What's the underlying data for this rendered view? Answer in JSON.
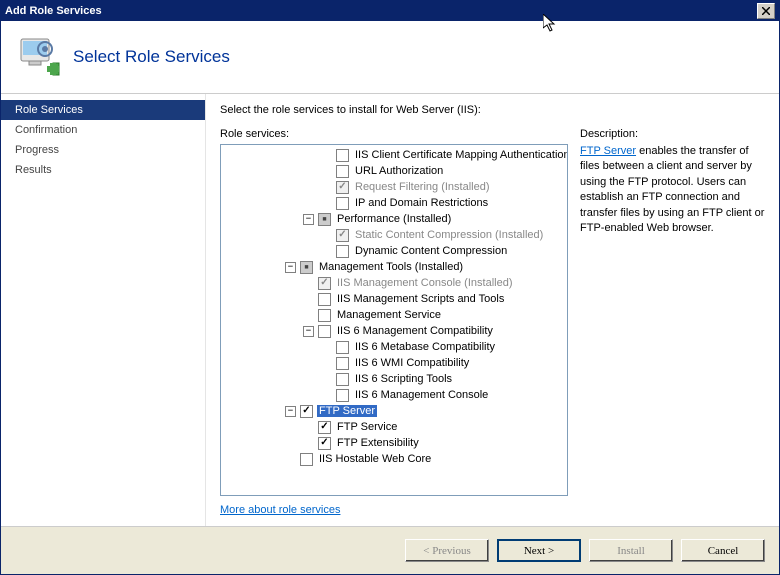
{
  "window": {
    "title": "Add Role Services"
  },
  "header": {
    "title": "Select Role Services"
  },
  "sidebar": {
    "items": [
      {
        "label": "Role Services",
        "active": true
      },
      {
        "label": "Confirmation",
        "active": false
      },
      {
        "label": "Progress",
        "active": false
      },
      {
        "label": "Results",
        "active": false
      }
    ]
  },
  "main": {
    "instruction": "Select the role services to install for Web Server (IIS):",
    "tree_label": "Role services:",
    "desc_label": "Description:",
    "link_text": "More about role services"
  },
  "tree": [
    {
      "indent": 3,
      "cb": "unchecked",
      "label": "IIS Client Certificate Mapping Authentication"
    },
    {
      "indent": 3,
      "cb": "unchecked",
      "label": "URL Authorization"
    },
    {
      "indent": 3,
      "cb": "checked",
      "disabled": true,
      "label": "Request Filtering  (Installed)"
    },
    {
      "indent": 3,
      "cb": "unchecked",
      "label": "IP and Domain Restrictions"
    },
    {
      "indent": 2,
      "exp": "-",
      "cb": "mixed",
      "label": "Performance  (Installed)"
    },
    {
      "indent": 3,
      "cb": "checked",
      "disabled": true,
      "label": "Static Content Compression  (Installed)"
    },
    {
      "indent": 3,
      "cb": "unchecked",
      "label": "Dynamic Content Compression"
    },
    {
      "indent": 1,
      "exp": "-",
      "cb": "mixed",
      "label": "Management Tools  (Installed)"
    },
    {
      "indent": 2,
      "cb": "checked",
      "disabled": true,
      "label": "IIS Management Console  (Installed)"
    },
    {
      "indent": 2,
      "cb": "unchecked",
      "label": "IIS Management Scripts and Tools"
    },
    {
      "indent": 2,
      "cb": "unchecked",
      "label": "Management Service"
    },
    {
      "indent": 2,
      "exp": "-",
      "cb": "unchecked",
      "label": "IIS 6 Management Compatibility"
    },
    {
      "indent": 3,
      "cb": "unchecked",
      "label": "IIS 6 Metabase Compatibility"
    },
    {
      "indent": 3,
      "cb": "unchecked",
      "label": "IIS 6 WMI Compatibility"
    },
    {
      "indent": 3,
      "cb": "unchecked",
      "label": "IIS 6 Scripting Tools"
    },
    {
      "indent": 3,
      "cb": "unchecked",
      "label": "IIS 6 Management Console"
    },
    {
      "indent": 1,
      "exp": "-",
      "cb": "checked",
      "label": "FTP Server",
      "selected": true
    },
    {
      "indent": 2,
      "cb": "checked",
      "label": "FTP Service"
    },
    {
      "indent": 2,
      "cb": "checked",
      "label": "FTP Extensibility"
    },
    {
      "indent": 1,
      "cb": "unchecked",
      "label": "IIS Hostable Web Core"
    }
  ],
  "description": {
    "title": "FTP Server",
    "body": " enables the transfer of files between a client and server by using the FTP protocol. Users can establish an FTP connection and transfer files by using an FTP client or FTP-enabled Web browser."
  },
  "footer": {
    "previous": "< Previous",
    "next": "Next >",
    "install": "Install",
    "cancel": "Cancel"
  }
}
